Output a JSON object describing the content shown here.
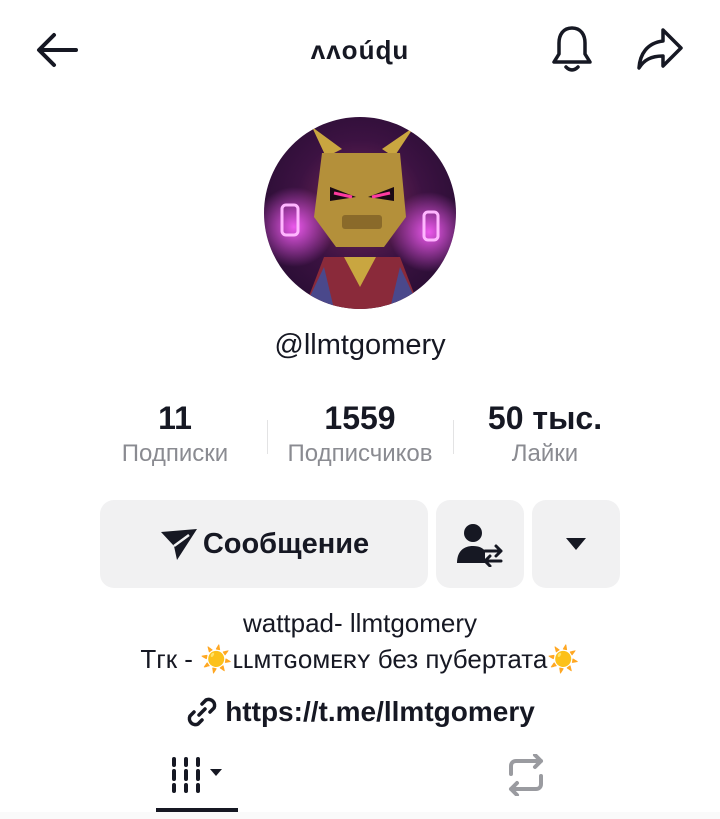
{
  "header": {
    "title": "ʌʌoúɖu",
    "back_icon": "arrow-left-icon",
    "bell_icon": "bell-icon",
    "share_icon": "share-arrow-icon"
  },
  "profile": {
    "avatar_icon": "avatar-image",
    "username": "@llmtgomery"
  },
  "stats": [
    {
      "value": "11",
      "label": "Подписки"
    },
    {
      "value": "1559",
      "label": "Подписчиков"
    },
    {
      "value": "50 тыс.",
      "label": "Лайки"
    }
  ],
  "buttons": {
    "message_label": "Сообщение",
    "message_icon": "send-icon",
    "friend_icon": "add-friend-swap-icon",
    "more_icon": "caret-down-icon"
  },
  "bio": {
    "line1": "wattpad- llmtgomery",
    "line2_prefix": "Тгк - ",
    "line2_sun": "☀️",
    "line2_name": "ʟʟᴍᴛɢᴏᴍᴇʀʏ",
    "line2_suffix": " без пубертата",
    "link": "https://t.me/llmtgomery",
    "link_icon": "link-icon"
  },
  "tabs": {
    "videos_icon": "grid-icon",
    "reposts_icon": "repost-icon"
  },
  "colors": {
    "text": "#161823",
    "muted": "#8a8b91",
    "button_bg": "#f1f1f2"
  }
}
